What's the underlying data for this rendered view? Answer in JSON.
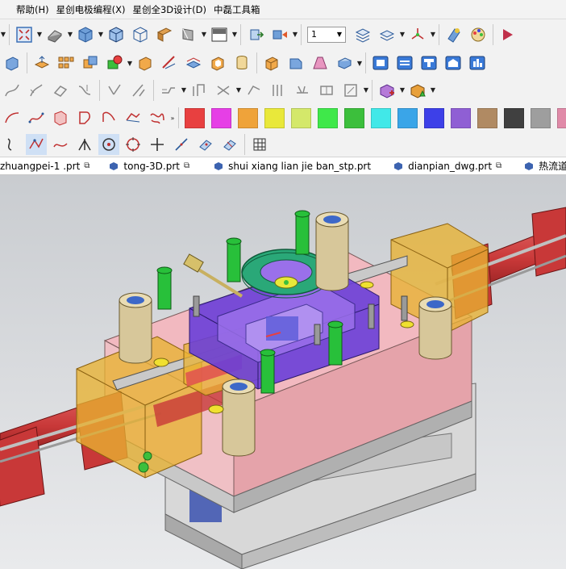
{
  "menubar": {
    "items": [
      "帮助(H)",
      "星创电极编程(X)",
      "星创全3D设计(D)",
      "中磊工具箱"
    ]
  },
  "toolbar": {
    "zoom_value": "1"
  },
  "colors": {
    "palette": [
      "#e84040",
      "#e63fe6",
      "#efa33a",
      "#e9e83a",
      "#d4e86a",
      "#3fe84a",
      "#3cbf3c",
      "#41e8e8",
      "#3aa5e8",
      "#3d40e8",
      "#8f5fd4",
      "#b08a63",
      "#404040",
      "#9e9e9e",
      "#e08aa8",
      "#e07a74"
    ]
  },
  "tabs": [
    {
      "label": "zhuangpei-1 .prt",
      "icon": "cube-icon"
    },
    {
      "label": "tong-3D.prt",
      "icon": "cube-icon"
    },
    {
      "label": "shui xiang lian jie ban_stp.prt",
      "icon": "part-icon"
    },
    {
      "label": "dianpian_dwg.prt",
      "icon": "part-icon"
    },
    {
      "label": "热流道",
      "icon": "part-icon"
    }
  ]
}
